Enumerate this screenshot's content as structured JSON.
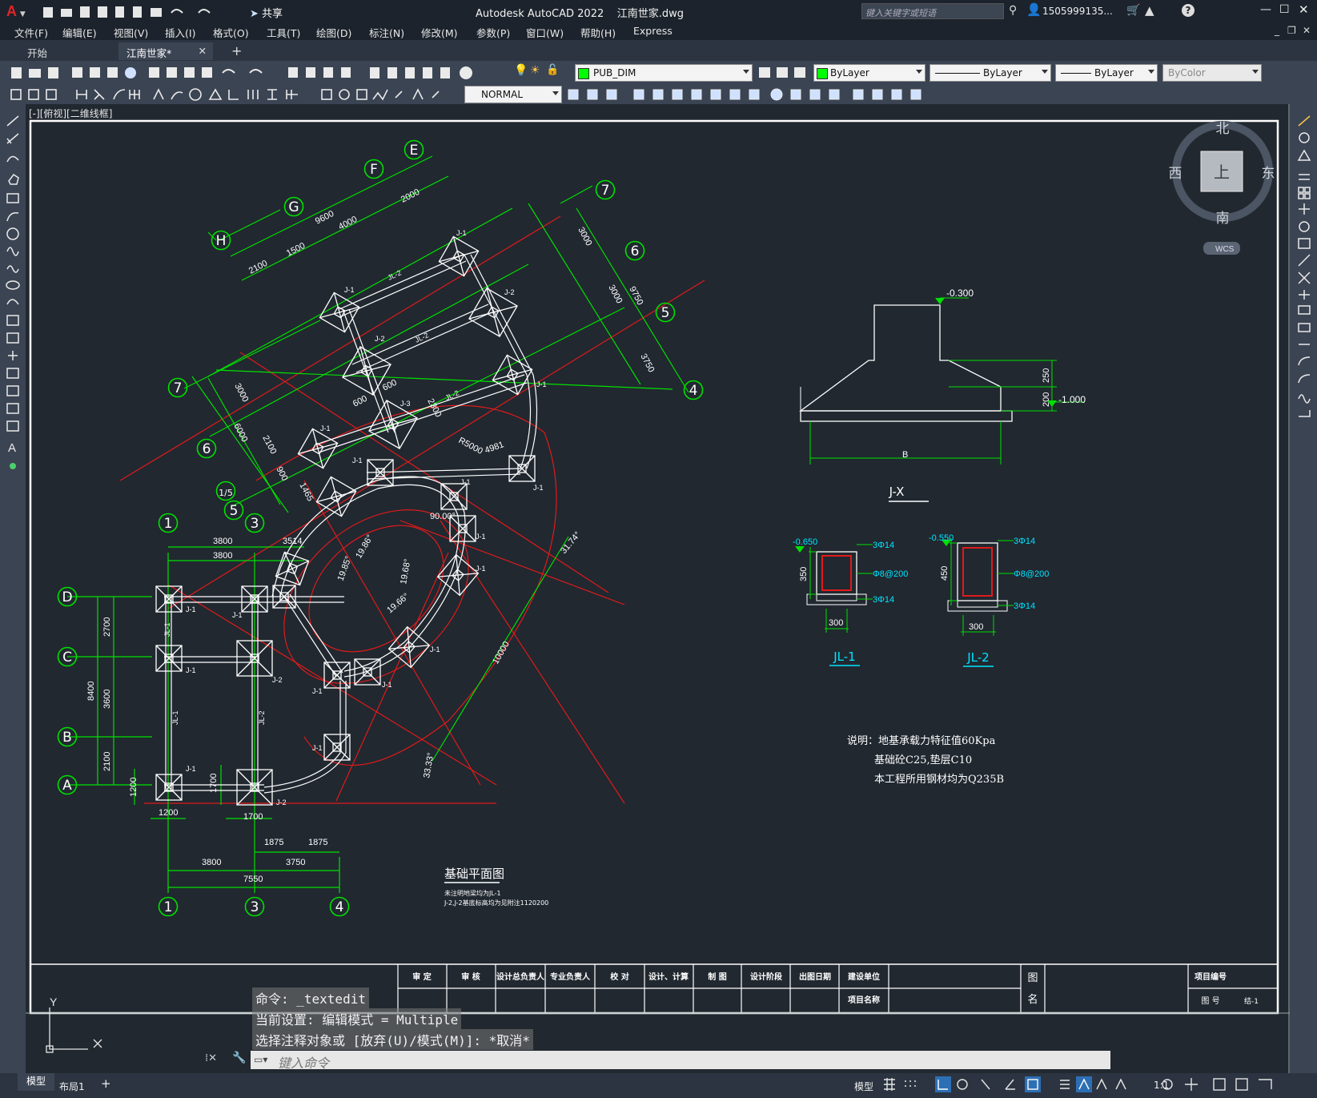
{
  "app": {
    "title": "Autodesk AutoCAD 2022    江南世家.dwg",
    "share_label": "共享",
    "search_placeholder": "键入关键字或短语",
    "user": "1505999135...",
    "logo": "A"
  },
  "menu": [
    "文件(F)",
    "编辑(E)",
    "视图(V)",
    "插入(I)",
    "格式(O)",
    "工具(T)",
    "绘图(D)",
    "标注(N)",
    "修改(M)",
    "参数(P)",
    "窗口(W)",
    "帮助(H)",
    "Express"
  ],
  "tabs": {
    "start": "开始",
    "active": "江南世家*",
    "close": "✕",
    "add": "+"
  },
  "toolbar": {
    "layer": "PUB_DIM",
    "color": "ByLayer",
    "linetype": "ByLayer",
    "lineweight": "ByLayer",
    "plotstyle": "ByColor",
    "textstyle": "NORMAL",
    "layer_color": "#00ff00"
  },
  "viewport": {
    "label": "[-][俯视][二维线框]",
    "viewcube": {
      "north": "北",
      "south": "南",
      "east": "东",
      "west": "西",
      "top": "上",
      "wcs": "WCS"
    },
    "ucs_y": "Y"
  },
  "drawing": {
    "plan_title": "基础平面图",
    "plan_note1": "未注明地梁均为JL-1",
    "plan_note2": "J-2,J-2基底标高均为见附注1120200",
    "detail_jx": "J-X",
    "detail_jl1": "JL-1",
    "detail_jl2": "JL-2",
    "note1": "说明：地基承载力特征值60Kpa",
    "note2": "基础砼C25,垫层C10",
    "note3": "本工程所用钢材均为Q235B",
    "elev_top": "-0.300",
    "elev_bot": "-1.000",
    "dim_250": "250",
    "dim_200": "200",
    "dim_b": "B",
    "jl1_elev": "-0.650",
    "jl2_elev": "-0.550",
    "jl1_h": "350",
    "jl2_h": "450",
    "jl_w": "300",
    "rebar_top": "3Φ14",
    "rebar_stir": "Φ8@200",
    "rebar_bot": "3Φ14",
    "grid_left": [
      "D",
      "C",
      "B",
      "A"
    ],
    "grid_top": [
      "1",
      "3"
    ],
    "grid_bottom": [
      "1",
      "3",
      "4"
    ],
    "grid_rot1": [
      "H",
      "G",
      "F",
      "E"
    ],
    "grid_rot2": [
      "7",
      "6",
      "5",
      "4"
    ],
    "grid_rot3": [
      "7",
      "6",
      "1/5",
      "5"
    ],
    "dims_top1": "3800",
    "dims_top2": "3800",
    "dims_top3": "3514",
    "dims_left": [
      "2700",
      "3600",
      "2100",
      "8400",
      "1200",
      "1700"
    ],
    "dims_bottom": [
      "1200",
      "1700",
      "1875",
      "1875",
      "3800",
      "3750",
      "7550"
    ],
    "dims_rot": [
      "2100",
      "1500",
      "9600",
      "4000",
      "2000",
      "3000",
      "3000",
      "9750",
      "3750",
      "3000",
      "6000",
      "2100",
      "900",
      "1465",
      "2300",
      "600",
      "600"
    ],
    "r_label": "R5000",
    "r_4981": "4981",
    "angles": [
      "90.00°",
      "19.85°",
      "19.86°",
      "19.68°",
      "19.66°",
      "31.74°",
      "33.33°"
    ],
    "dim_10000": "10000",
    "footing_labels": [
      "J-1",
      "J-2",
      "J-3",
      "JL-1",
      "JL-2"
    ]
  },
  "titleblock": {
    "cells": [
      "审 定",
      "审 核",
      "设计总负责人",
      "专业负责人",
      "校 对",
      "设计、计算",
      "制 图",
      "设计阶段",
      "出图日期",
      "建设单位",
      "项目名称"
    ],
    "tu": "图",
    "ming": "名",
    "project_no": "项目编号",
    "tu_hao": "图 号",
    "sheet": "结-1"
  },
  "command": {
    "history": [
      "命令: _textedit",
      "当前设置: 编辑模式 = Multiple",
      "选择注释对象或 [放弃(U)/模式(M)]: *取消*"
    ],
    "placeholder": "键入命令"
  },
  "status": {
    "model_tab": "模型",
    "layout_tab": "布局1",
    "add": "+",
    "model": "模型",
    "scale": "1:1"
  }
}
